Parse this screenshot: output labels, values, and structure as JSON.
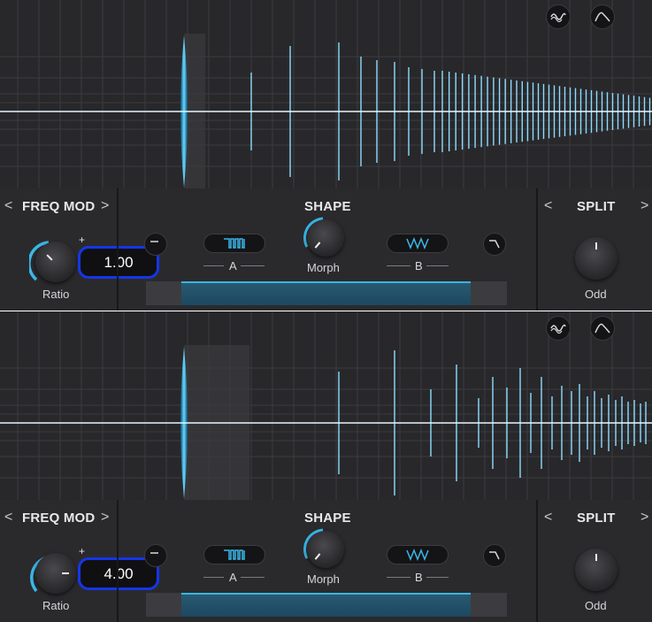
{
  "panels": [
    {
      "freq_mod": {
        "title": "FREQ MOD",
        "prev": "<",
        "next": ">",
        "knob_label": "Ratio",
        "value": "1.00"
      },
      "shape": {
        "title": "SHAPE",
        "knob_label": "Morph",
        "a_label": "A",
        "b_label": "B"
      },
      "split": {
        "title": "SPLIT",
        "prev": "<",
        "next": ">",
        "knob_label": "Odd"
      }
    },
    {
      "freq_mod": {
        "title": "FREQ MOD",
        "prev": "<",
        "next": ">",
        "knob_label": "Ratio",
        "value": "4.00"
      },
      "shape": {
        "title": "SHAPE",
        "knob_label": "Morph",
        "a_label": "A",
        "b_label": "B"
      },
      "split": {
        "title": "SPLIT",
        "prev": "<",
        "next": ">",
        "knob_label": "Odd"
      }
    }
  ],
  "icons": {
    "top_left": "sine-wave-icon",
    "top_right": "envelope-curve-icon",
    "shape_a": "square-wave-icon",
    "shape_b": "saw-wave-icon",
    "left_edge": "ramp-up-icon",
    "right_edge": "lowpass-icon"
  },
  "colors": {
    "accent": "#3ab8e8",
    "highlight": "#1536e8",
    "background": "#232326"
  }
}
